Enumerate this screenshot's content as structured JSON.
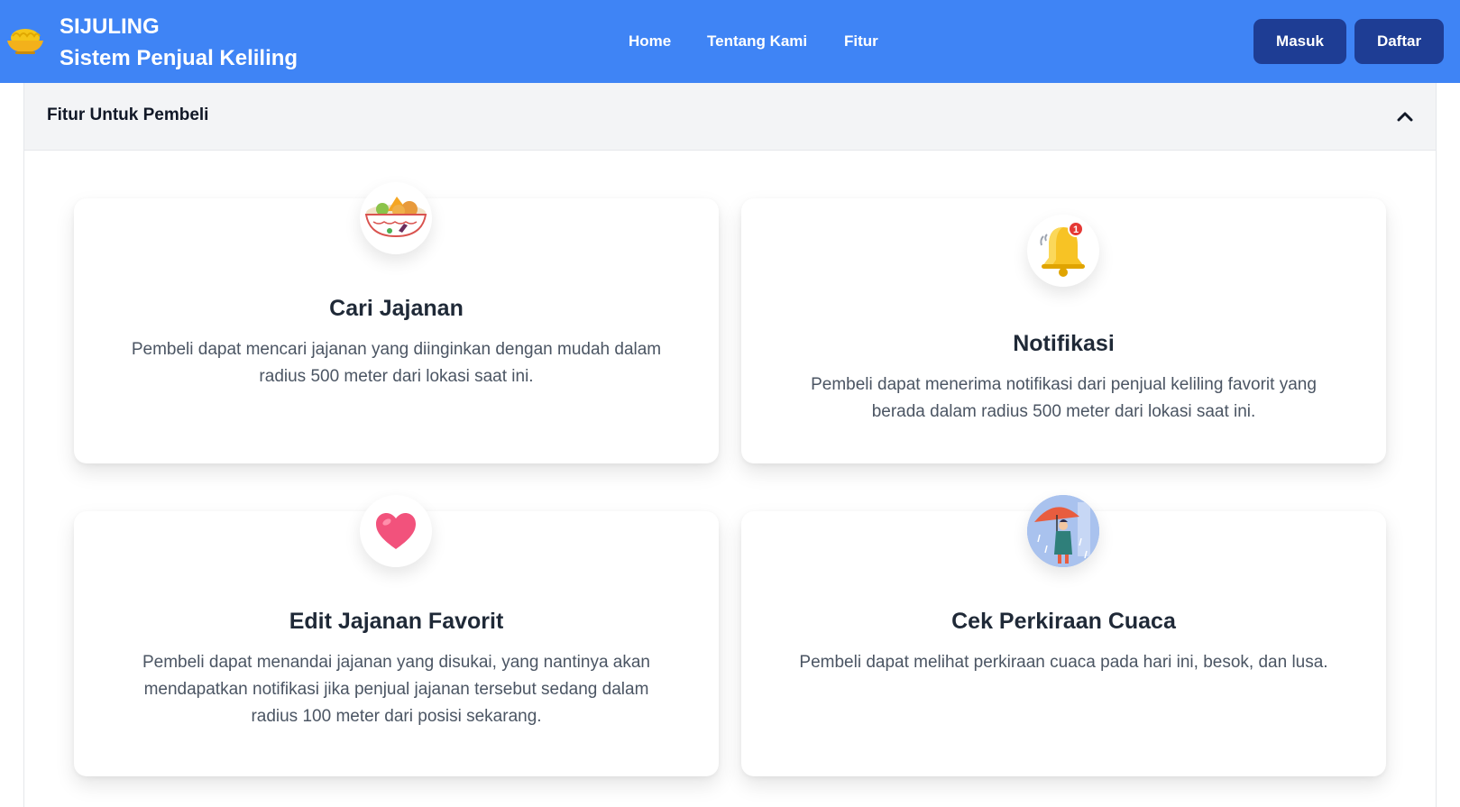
{
  "navbar": {
    "brand_title": "SIJULING",
    "brand_subtitle": "Sistem Penjual Keliling",
    "brand_icon": "noodle-bowl-icon",
    "links": [
      "Home",
      "Tentang Kami",
      "Fitur"
    ],
    "login_label": "Masuk",
    "register_label": "Daftar",
    "colors": {
      "background": "#3f84f5",
      "button": "#1e3d94"
    }
  },
  "accordion": {
    "title": "Fitur Untuk Pembeli",
    "state_icon": "chevron-up-icon",
    "header_background": "#f3f4f6"
  },
  "features": [
    {
      "icon": "food-bowl-icon",
      "title": "Cari Jajanan",
      "description": "Pembeli dapat mencari jajanan yang diinginkan dengan mudah dalam radius 500 meter dari lokasi saat ini."
    },
    {
      "icon": "notification-bell-icon",
      "badge": "1",
      "title": "Notifikasi",
      "description": "Pembeli dapat menerima notifikasi dari penjual keliling favorit yang berada dalam radius 500 meter dari lokasi saat ini."
    },
    {
      "icon": "heart-icon",
      "title": "Edit Jajanan Favorit",
      "description": "Pembeli dapat menandai jajanan yang disukai, yang nantinya akan mendapatkan notifikasi jika penjual jajanan tersebut sedang dalam radius 100 meter dari posisi sekarang."
    },
    {
      "icon": "rain-umbrella-icon",
      "title": "Cek Perkiraan Cuaca",
      "description": "Pembeli dapat melihat perkiraan cuaca pada hari ini, besok, dan lusa."
    }
  ]
}
